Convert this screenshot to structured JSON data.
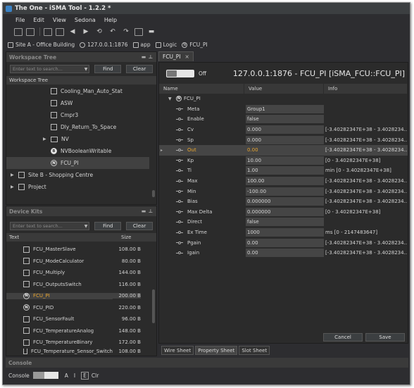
{
  "window": {
    "title": "The One - iSMA Tool - 1.2.2 *"
  },
  "menu": {
    "file": "File",
    "edit": "Edit",
    "view": "View",
    "sedona": "Sedona",
    "help": "Help"
  },
  "breadcrumb": {
    "site": "Site A - Office Building",
    "device": "127.0.0.1:1876",
    "app": "app",
    "logic": "Logic",
    "component": "FCU_PI"
  },
  "workspace": {
    "header": "Workspace Tree",
    "search_placeholder": "Enter text to search...",
    "find": "Find",
    "clear": "Clear",
    "subheader": "Workspace Tree",
    "items": [
      {
        "label": "Cooling_Man_Auto_Stat",
        "icon": "component-icon"
      },
      {
        "label": "ASW",
        "icon": "component-icon"
      },
      {
        "label": "Cmpr3",
        "icon": "component-icon"
      },
      {
        "label": "Dly_Return_To_Space",
        "icon": "component-icon"
      },
      {
        "label": "NV",
        "icon": "folder-icon"
      },
      {
        "label": "NVBooleanWritable",
        "icon": "b-icon"
      },
      {
        "label": "FCU_PI",
        "icon": "n-icon"
      },
      {
        "label": "Site B - Shopping Centre",
        "icon": "site-icon"
      },
      {
        "label": "Project",
        "icon": "project-icon"
      }
    ]
  },
  "devicekits": {
    "header": "Device Kits",
    "search_placeholder": "Enter text to search...",
    "find": "Find",
    "clear": "Clear",
    "col_text": "Text",
    "col_size": "Size",
    "items": [
      {
        "name": "FCU_MasterSlave",
        "size": "108.00 B"
      },
      {
        "name": "FCU_ModeCalculator",
        "size": "80.00 B"
      },
      {
        "name": "FCU_Multiply",
        "size": "144.00 B"
      },
      {
        "name": "FCU_OutputsSwitch",
        "size": "116.00 B"
      },
      {
        "name": "FCU_PI",
        "size": "200.00 B"
      },
      {
        "name": "FCU_PID",
        "size": "220.00 B"
      },
      {
        "name": "FCU_SensorFault",
        "size": "96.00 B"
      },
      {
        "name": "FCU_TemperatureAnalog",
        "size": "148.00 B"
      },
      {
        "name": "FCU_TemperatureBinary",
        "size": "172.00 B"
      },
      {
        "name": "FCU_Temperature_Sensor_Switch",
        "size": "108.00 B"
      }
    ]
  },
  "editor": {
    "tab_label": "FCU_PI",
    "tab_close": "×",
    "toggle_label": "Off",
    "title": "127.0.0.1:1876 - FCU_PI [iSMA_FCU::FCU_PI]",
    "col_name": "Name",
    "col_value": "Value",
    "col_info": "Info",
    "root": "FCU_PI",
    "rows": [
      {
        "name": "Meta",
        "value": "Group1",
        "info": ""
      },
      {
        "name": "Enable",
        "value": "false",
        "info": ""
      },
      {
        "name": "Cv",
        "value": "0.000",
        "info": "[-3.40282347E+38 - 3.4028234..."
      },
      {
        "name": "Sp",
        "value": "0.000",
        "info": "[-3.40282347E+38 - 3.4028234..."
      },
      {
        "name": "Out",
        "value": "0.00",
        "info": "[-3.40282347E+38 - 3.4028234..."
      },
      {
        "name": "Kp",
        "value": "10.00",
        "info": "[0 - 3.40282347E+38]"
      },
      {
        "name": "Ti",
        "value": "1.00",
        "info": "min [0 - 3.40282347E+38]"
      },
      {
        "name": "Max",
        "value": "100.00",
        "info": "[-3.40282347E+38 - 3.4028234..."
      },
      {
        "name": "Min",
        "value": "-100.00",
        "info": "[-3.40282347E+38 - 3.4028234..."
      },
      {
        "name": "Bias",
        "value": "0.000000",
        "info": "[-3.40282347E+38 - 3.4028234..."
      },
      {
        "name": "Max Delta",
        "value": "0.000000",
        "info": "[0 - 3.40282347E+38]"
      },
      {
        "name": "Direct",
        "value": "false",
        "info": ""
      },
      {
        "name": "Ex Time",
        "value": "1000",
        "info": "ms [0 - 2147483647]"
      },
      {
        "name": "Pgain",
        "value": "0.00",
        "info": "[-3.40282347E+38 - 3.4028234..."
      },
      {
        "name": "Igain",
        "value": "0.00",
        "info": "[-3.40282347E+38 - 3.4028234..."
      }
    ],
    "cancel": "Cancel",
    "save": "Save"
  },
  "bottom_tabs": {
    "wire": "Wire Sheet",
    "property": "Property Sheet",
    "slot": "Slot Sheet"
  },
  "console": {
    "header": "Console",
    "label": "Console",
    "a": "A",
    "i": "I",
    "e": "E",
    "clr": "Clr"
  },
  "colors": {
    "highlight_value": "#e8a530",
    "highlight_name": "#e8a530"
  }
}
